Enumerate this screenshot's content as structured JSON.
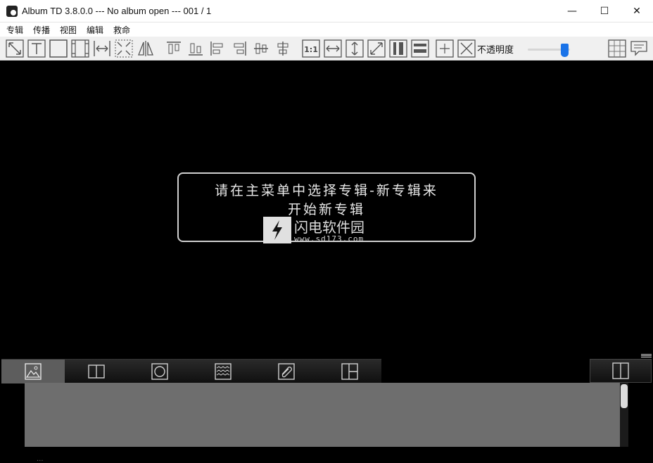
{
  "window": {
    "title": "Album TD 3.8.0.0 --- No album open --- 001 / 1",
    "minimize": "—",
    "maximize": "☐",
    "close": "✕"
  },
  "menu": [
    "专辑",
    "传播",
    "视图",
    "编辑",
    "救命"
  ],
  "toolbar": {
    "icons": [
      "fit-diagonal-icon",
      "text-frame-icon",
      "frame-icon",
      "film-strip-icon",
      "horizontal-spacing-icon",
      "shrink-icon",
      "mirror-icon",
      "align-top-icon",
      "align-bottom-icon",
      "align-left-icon",
      "align-right-icon",
      "center-horizontal-icon",
      "center-vertical-icon",
      "actual-size-icon",
      "fit-width-icon",
      "fit-height-icon",
      "fit-page-icon",
      "vertical-columns-icon",
      "horizontal-rows-icon",
      "add-icon",
      "delete-icon"
    ],
    "opacity_label": "不透明度",
    "opacity_value": 0.88,
    "right_icons": [
      "grid-icon",
      "comment-icon"
    ]
  },
  "canvas": {
    "message_line1": "请在主菜单中选择专辑-新专辑来",
    "message_line2": "开始新专辑",
    "watermark_title": "闪电软件园",
    "watermark_url": "www.sd173.com"
  },
  "bottom": {
    "tabs": [
      "image-icon",
      "split-panel-icon",
      "circle-icon",
      "waves-icon",
      "clip-icon",
      "layout-icon"
    ],
    "side_tab": "split-panel-icon",
    "fragment": "..."
  }
}
